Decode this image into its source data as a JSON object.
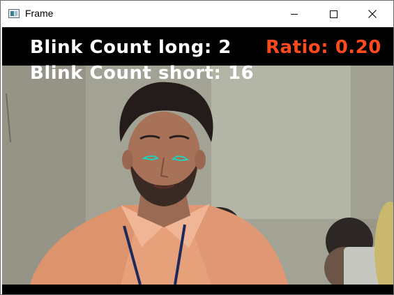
{
  "window": {
    "title": "Frame"
  },
  "overlay": {
    "blink_long": "Blink Count long: 2",
    "blink_short": "Blink Count short: 16",
    "ratio": "Ratio: 0.20"
  },
  "colors": {
    "overlay_text": "#ffffff",
    "ratio_text": "#ff4a1e",
    "eye_contour": "#00e5d0",
    "frame_bg": "#000000"
  },
  "icons": [
    "app-icon",
    "minimize-icon",
    "maximize-icon",
    "close-icon"
  ]
}
